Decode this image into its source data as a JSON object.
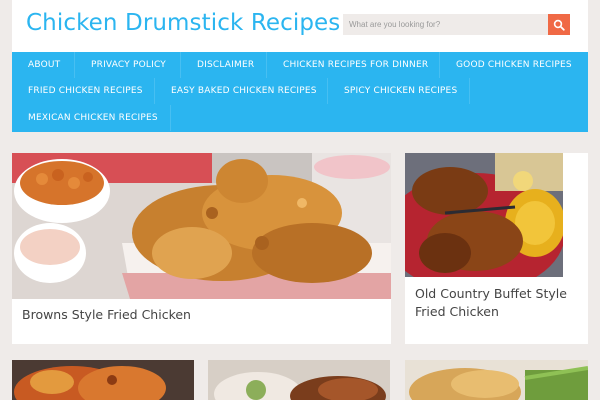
{
  "site": {
    "title": "Chicken Drumstick Recipes"
  },
  "search": {
    "placeholder": "What are you looking for?"
  },
  "nav": {
    "items": [
      "About",
      "Privacy Policy",
      "Disclaimer",
      "Chicken Recipes for Dinner",
      "Good Chicken Recipes",
      "Fried Chicken Recipes",
      "Easy Baked Chicken Recipes",
      "Spicy Chicken Recipes",
      "Mexican Chicken Recipes"
    ]
  },
  "posts": [
    {
      "title": "Browns Style Fried Chicken"
    },
    {
      "title": "Old Country Buffet Style Fried Chicken"
    }
  ],
  "colors": {
    "accent": "#2bb5f0",
    "search_button": "#f06945",
    "page_bg": "#efebe9"
  },
  "icons": {
    "search": "search-icon"
  }
}
